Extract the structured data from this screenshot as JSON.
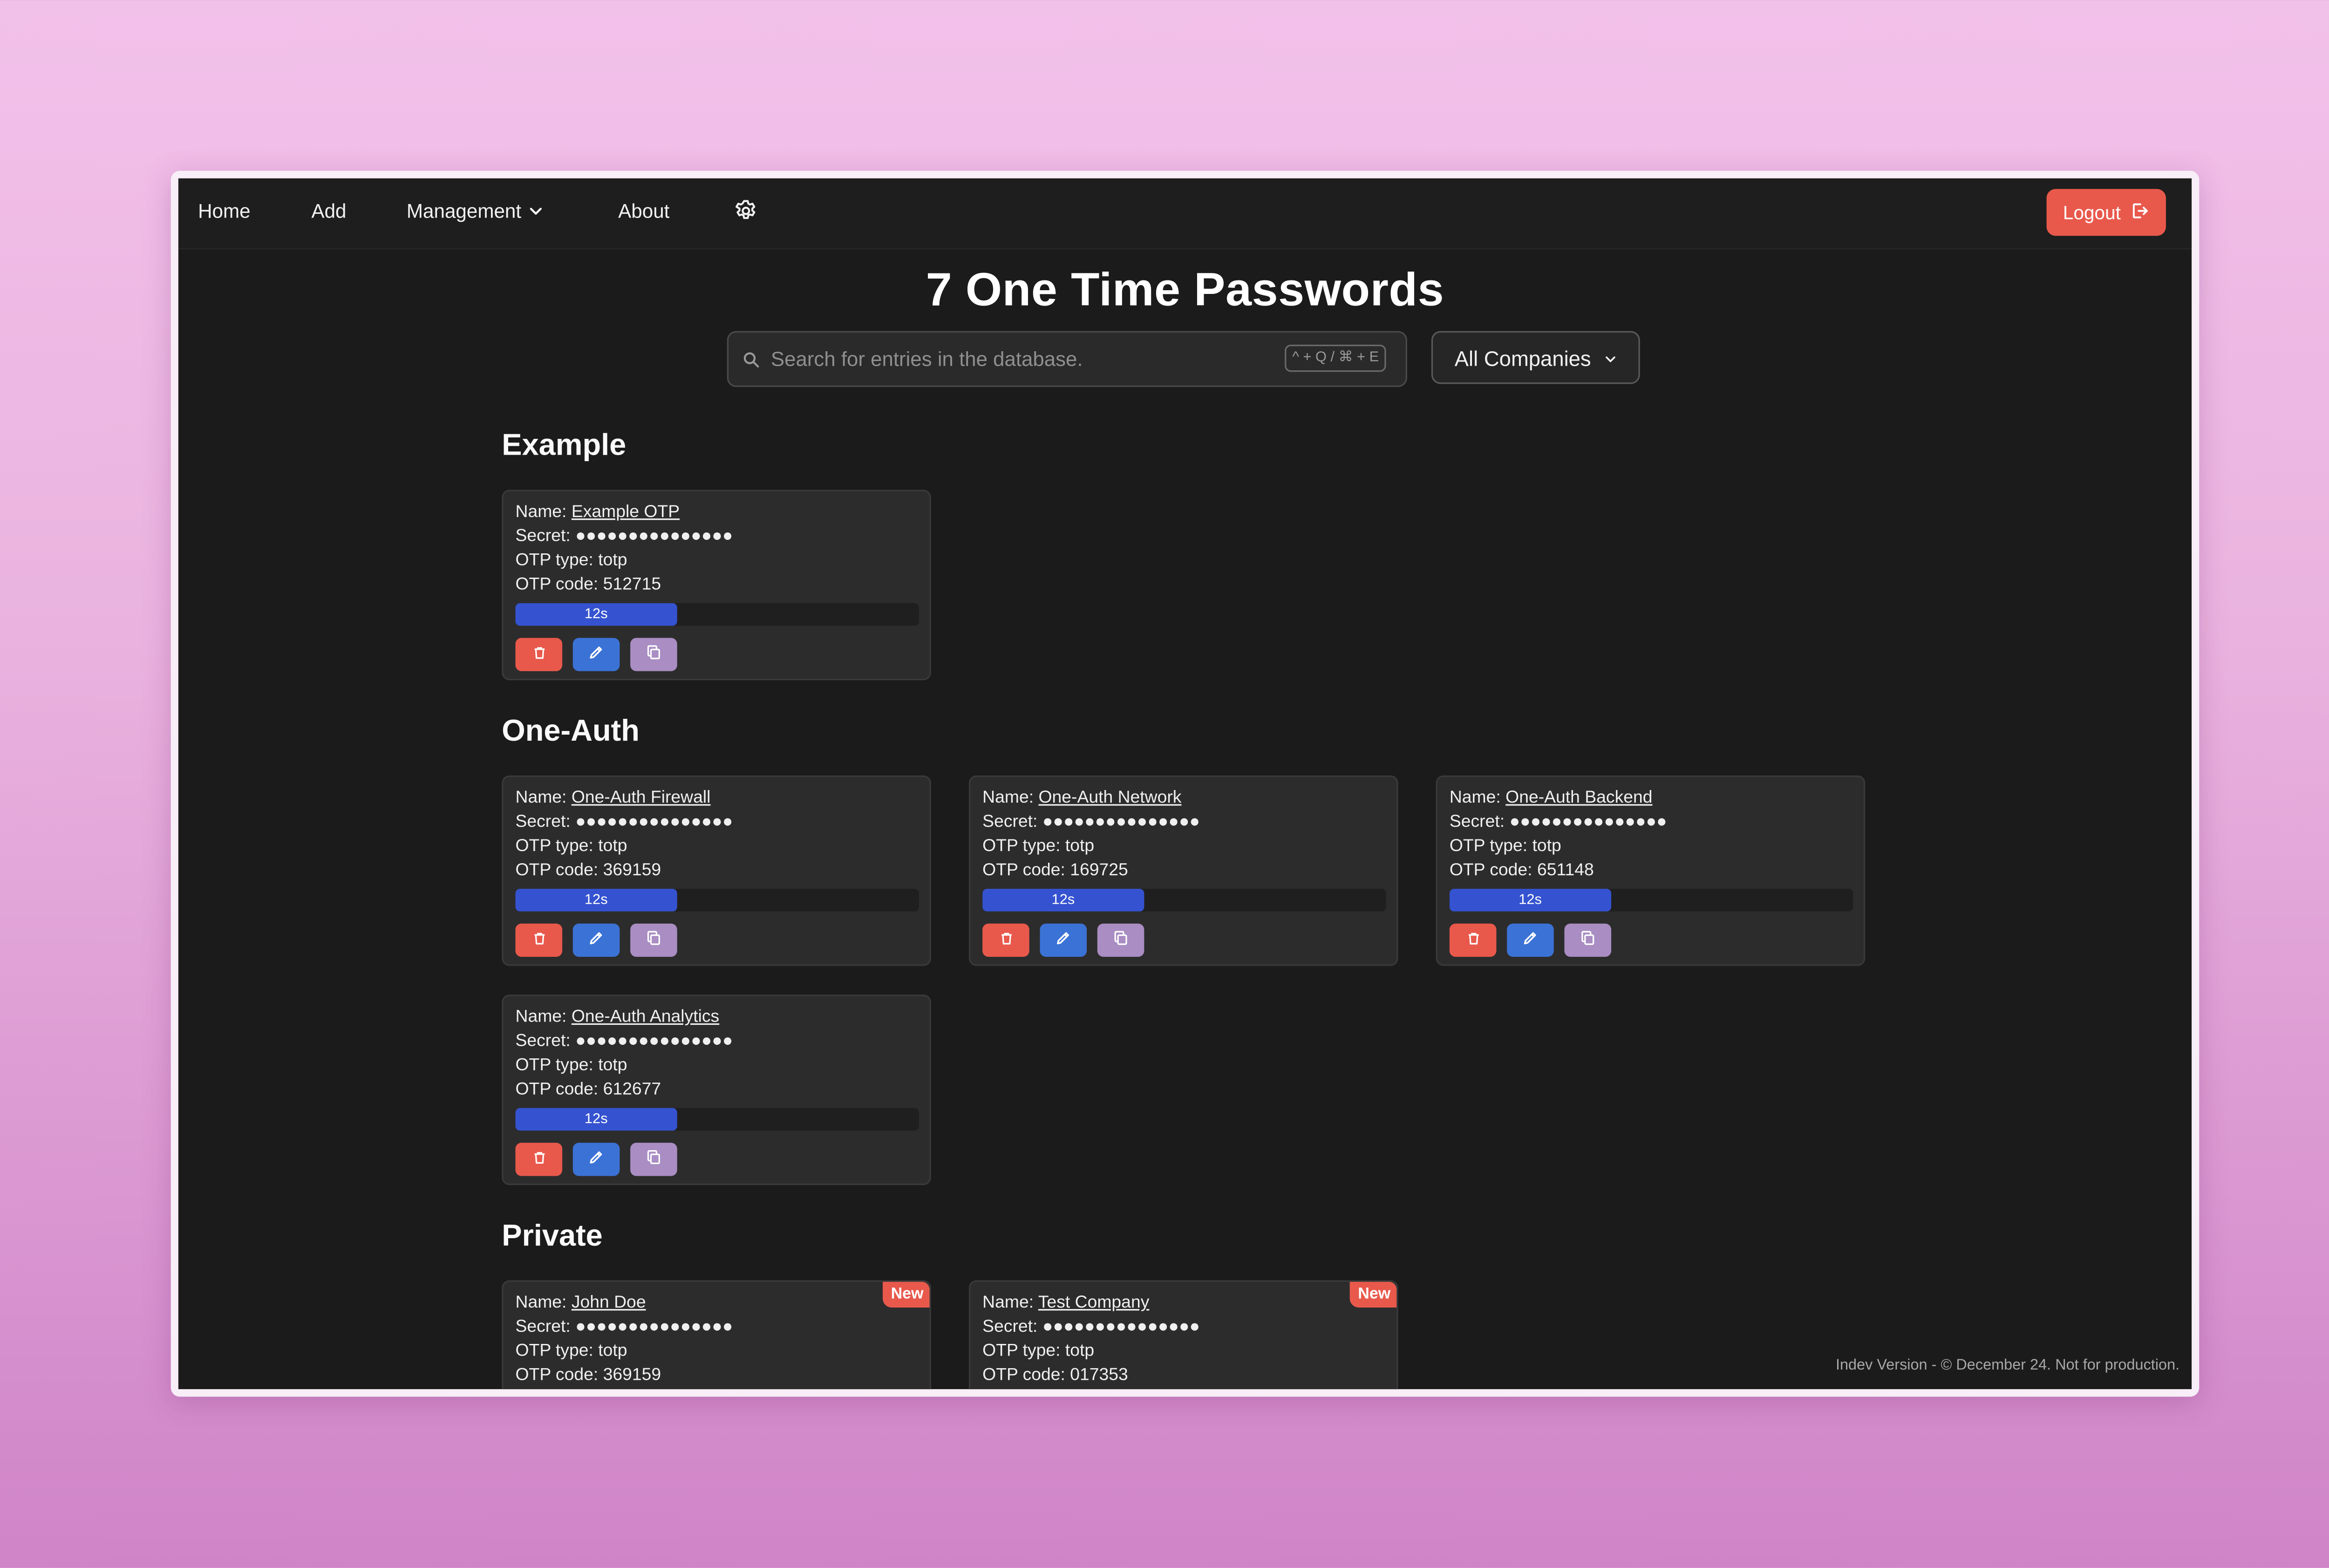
{
  "nav": {
    "home": "Home",
    "add": "Add",
    "management": "Management",
    "about": "About",
    "settings_icon": "gear-icon",
    "logout": "Logout",
    "logout_icon": "logout-icon"
  },
  "page_title": "7 One Time Passwords",
  "search": {
    "placeholder": "Search for entries in the database.",
    "shortcut": "^ + Q / ⌘ + E",
    "icon": "search-icon"
  },
  "company_filter": {
    "selected": "All Companies"
  },
  "sections": [
    {
      "title": "Example",
      "cards": [
        {
          "name_label": "Name:",
          "name": "Example OTP",
          "secret_label": "Secret:",
          "secret": "●●●●●●●●●●●●●●●",
          "type_label": "OTP type:",
          "type": "totp",
          "code_label": "OTP code:",
          "code": "512715",
          "timer": "12s",
          "timer_fraction": 0.4
        }
      ]
    },
    {
      "title": "One-Auth",
      "cards": [
        {
          "name_label": "Name:",
          "name": "One-Auth Firewall",
          "secret_label": "Secret:",
          "secret": "●●●●●●●●●●●●●●●",
          "type_label": "OTP type:",
          "type": "totp",
          "code_label": "OTP code:",
          "code": "369159",
          "timer": "12s",
          "timer_fraction": 0.4
        },
        {
          "name_label": "Name:",
          "name": "One-Auth Network",
          "secret_label": "Secret:",
          "secret": "●●●●●●●●●●●●●●●",
          "type_label": "OTP type:",
          "type": "totp",
          "code_label": "OTP code:",
          "code": "169725",
          "timer": "12s",
          "timer_fraction": 0.4
        },
        {
          "name_label": "Name:",
          "name": "One-Auth Backend",
          "secret_label": "Secret:",
          "secret": "●●●●●●●●●●●●●●●",
          "type_label": "OTP type:",
          "type": "totp",
          "code_label": "OTP code:",
          "code": "651148",
          "timer": "12s",
          "timer_fraction": 0.4
        },
        {
          "name_label": "Name:",
          "name": "One-Auth Analytics",
          "secret_label": "Secret:",
          "secret": "●●●●●●●●●●●●●●●",
          "type_label": "OTP type:",
          "type": "totp",
          "code_label": "OTP code:",
          "code": "612677",
          "timer": "12s",
          "timer_fraction": 0.4
        }
      ]
    },
    {
      "title": "Private",
      "cards": [
        {
          "name_label": "Name:",
          "name": "John Doe",
          "secret_label": "Secret:",
          "secret": "●●●●●●●●●●●●●●●",
          "type_label": "OTP type:",
          "type": "totp",
          "code_label": "OTP code:",
          "code": "369159",
          "badge": "New"
        },
        {
          "name_label": "Name:",
          "name": "Test Company",
          "secret_label": "Secret:",
          "secret": "●●●●●●●●●●●●●●●",
          "type_label": "OTP type:",
          "type": "totp",
          "code_label": "OTP code:",
          "code": "017353",
          "badge": "New"
        }
      ]
    }
  ],
  "footer": "Indev Version - © December 24. Not for production.",
  "colors": {
    "accent_red": "#e8594c",
    "accent_blue": "#3b72d6",
    "progress_blue": "#3553d0",
    "copy_purple": "#a98dc3",
    "background": "#1b1b1b",
    "card": "#2c2c2c"
  }
}
